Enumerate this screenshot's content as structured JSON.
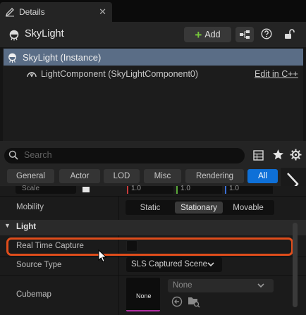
{
  "tab": {
    "title": "Details",
    "close": "✕"
  },
  "header": {
    "actor_name": "SkyLight",
    "add_label": "Add",
    "add_plus": "+"
  },
  "tree": {
    "instance_label": "SkyLight (Instance)",
    "component_label": "LightComponent (SkyLightComponent0)",
    "edit_link": "Edit in C++"
  },
  "search": {
    "placeholder": "Search"
  },
  "filters": [
    {
      "label": "General",
      "active": false
    },
    {
      "label": "Actor",
      "active": false
    },
    {
      "label": "LOD",
      "active": false
    },
    {
      "label": "Misc",
      "active": false
    },
    {
      "label": "Rendering",
      "active": false
    },
    {
      "label": "All",
      "active": true
    }
  ],
  "transform_partial": {
    "scale_label": "Scale",
    "x": "1.0",
    "y": "1.0",
    "z": "1.0"
  },
  "mobility": {
    "label": "Mobility",
    "options": [
      "Static",
      "Stationary",
      "Movable"
    ],
    "selected": "Stationary"
  },
  "category": {
    "label": "Light",
    "arrow": "▼"
  },
  "properties": {
    "real_time_capture": {
      "label": "Real Time Capture",
      "checked": false
    },
    "source_type": {
      "label": "Source Type",
      "value": "SLS Captured Scene"
    },
    "cubemap": {
      "label": "Cubemap",
      "thumbnail_text": "None",
      "asset_value": "None"
    }
  },
  "colors": {
    "highlight": "#e04d1b",
    "active_filter": "#0e70d8",
    "selection_row": "#5a6d86",
    "add_plus": "#77c83c"
  }
}
